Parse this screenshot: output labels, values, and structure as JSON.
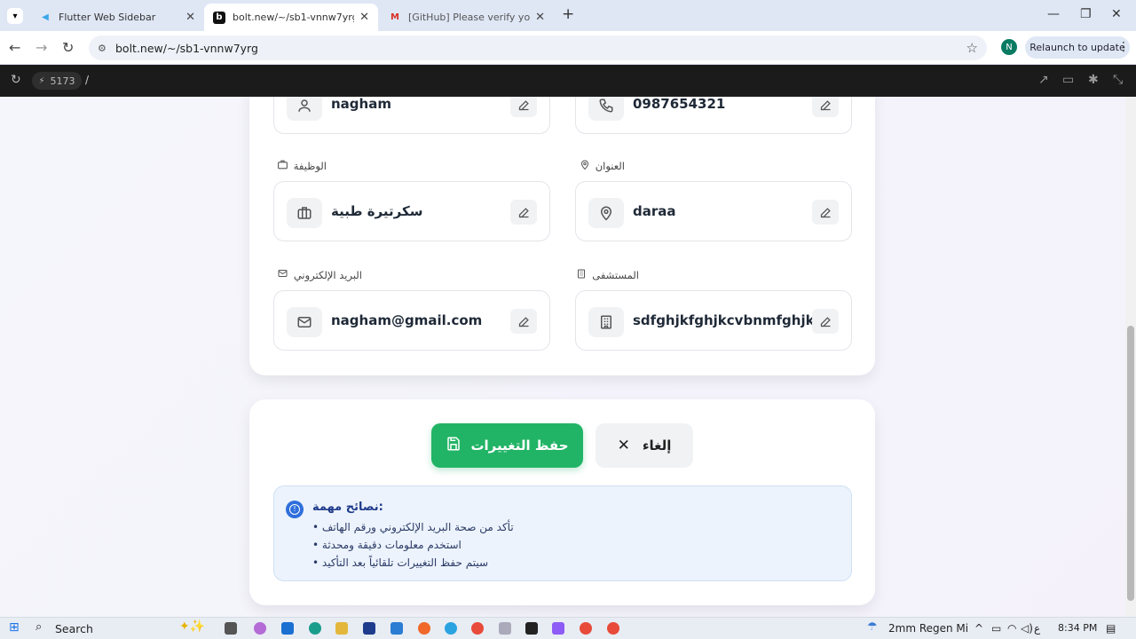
{
  "browser": {
    "tabs": [
      {
        "title": "Flutter Web Sidebar"
      },
      {
        "title": "bolt.new/~/sb1-vnnw7yrg"
      },
      {
        "title": "[GitHub] Please verify your devi"
      }
    ],
    "url": "bolt.new/~/sb1-vnnw7yrg",
    "avatar_letter": "N",
    "relaunch_label": "Relaunch to update"
  },
  "devbar": {
    "port": "5173",
    "path": "/"
  },
  "profile": {
    "row1": {
      "name_value": "nagham",
      "phone_value": "0987654321"
    },
    "job": {
      "label": "الوظيفة",
      "value": "سكرتيرة طبية"
    },
    "address": {
      "label": "العنوان",
      "value": "daraa"
    },
    "email": {
      "label": "البريد الإلكتروني",
      "value": "nagham@gmail.com"
    },
    "hospital": {
      "label": "المستشفى",
      "value": "sdfghjkfghjkcvbnmfghjk"
    }
  },
  "actions": {
    "save_label": "حفظ التغييرات",
    "cancel_label": "إلغاء"
  },
  "tips": {
    "title": ":نصائح مهمة",
    "items": [
      "تأكد من صحة البريد الإلكتروني ورقم الهاتف •",
      "استخدم معلومات دقيقة ومحدثة •",
      "سيتم حفظ التغييرات تلقائياً بعد التأكيد •"
    ]
  },
  "taskbar": {
    "search_label": "Search",
    "weather": "2mm Regen Mi",
    "lang": "ع",
    "time": "8:34 PM"
  },
  "colors": {
    "save": "#22b466",
    "tips_bg": "#ecf3fc"
  }
}
